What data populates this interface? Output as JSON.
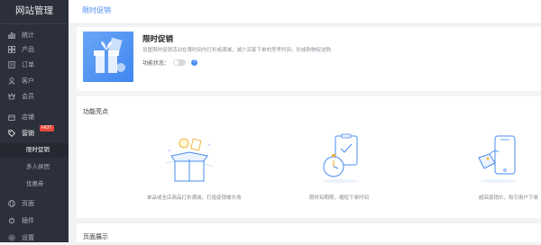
{
  "sidebar": {
    "title": "网站管理",
    "items": [
      {
        "label": "统计",
        "icon": "chart-icon"
      },
      {
        "label": "产品",
        "icon": "grid-icon"
      },
      {
        "label": "订单",
        "icon": "list-icon"
      },
      {
        "label": "客户",
        "icon": "user-icon"
      },
      {
        "label": "会员",
        "icon": "crown-icon"
      },
      {
        "label": "店铺",
        "icon": "store-icon"
      },
      {
        "label": "营销",
        "icon": "tag-icon",
        "badge": "HOT"
      }
    ],
    "sub_items": [
      {
        "label": "限时促销",
        "active": true
      },
      {
        "label": "多人拼团",
        "active": false
      },
      {
        "label": "优惠券",
        "active": false
      }
    ],
    "bottom_items": [
      {
        "label": "页面",
        "icon": "globe-icon"
      },
      {
        "label": "插件",
        "icon": "plug-icon"
      },
      {
        "label": "设置",
        "icon": "gear-icon"
      }
    ]
  },
  "topbar": {
    "breadcrumb": "限时促销"
  },
  "promo": {
    "title": "限时促销",
    "description": "设置限时促销活动在限时间内打折或满减，减少买家下单的思考时间，形成购物促进购",
    "switch_label": "功能状态：",
    "switch_on": false,
    "help": "?"
  },
  "features": {
    "title": "功能亮点",
    "items": [
      {
        "caption": "单品或全店商品打折满减，打造促销噱头场",
        "icon": "gift-box-icon"
      },
      {
        "caption": "限时有期限，缩短下单时间",
        "icon": "stopwatch-icon"
      },
      {
        "caption": "超高促销价，吸引用户下单",
        "icon": "price-tag-icon"
      }
    ]
  },
  "display": {
    "title": "页面展示"
  },
  "colors": {
    "sidebar_bg": "#2c303b",
    "accent": "#4a8df0",
    "badge": "#e8483b"
  }
}
